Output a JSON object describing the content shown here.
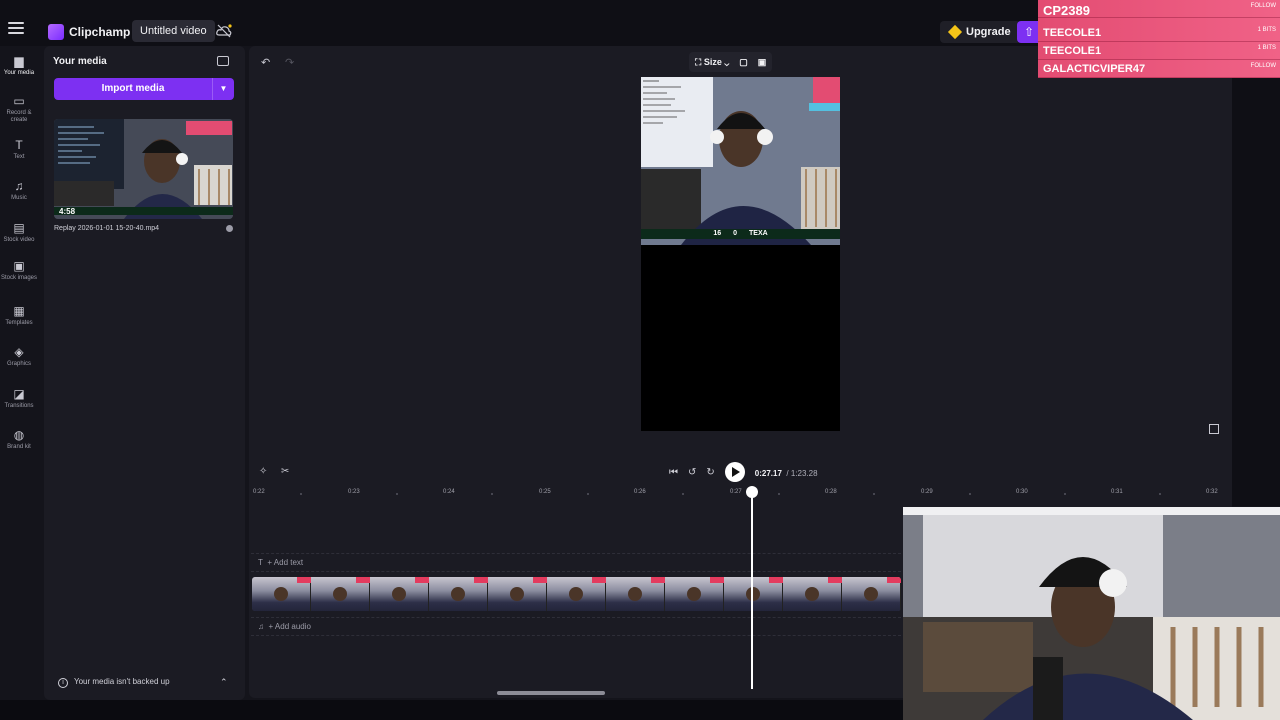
{
  "topbar": {
    "app_name": "Clipchamp",
    "project_title": "Untitled video",
    "upgrade_label": "Upgrade"
  },
  "rail": {
    "items": [
      {
        "label": "Your media",
        "icon": "folder-icon"
      },
      {
        "label": "Record & create",
        "icon": "camera-icon"
      },
      {
        "label": "Text",
        "icon": "text-icon"
      },
      {
        "label": "Music",
        "icon": "music-icon"
      },
      {
        "label": "Stock video",
        "icon": "film-icon"
      },
      {
        "label": "Stock images",
        "icon": "image-icon"
      },
      {
        "label": "Templates",
        "icon": "templates-icon"
      },
      {
        "label": "Graphics",
        "icon": "shapes-icon"
      },
      {
        "label": "Transitions",
        "icon": "transitions-icon"
      },
      {
        "label": "Brand kit",
        "icon": "brand-kit-icon"
      }
    ]
  },
  "media_panel": {
    "title": "Your media",
    "import_label": "Import media",
    "clip": {
      "duration": "4:58",
      "filename": "Replay 2026-01-01 15-20-40.mp4"
    },
    "backup_note": "Your media isn't backed up"
  },
  "preview": {
    "size_label": "Size",
    "score": {
      "left": "16",
      "right": "0",
      "team_right": "TEXA"
    }
  },
  "playback": {
    "current_time": "0:27.17",
    "total_time": "/ 1:23.28"
  },
  "ruler": {
    "labels": [
      "0:22",
      "0:23",
      "0:24",
      "0:25",
      "0:26",
      "0:27",
      "0:28",
      "0:29",
      "0:30",
      "0:31",
      "0:32"
    ]
  },
  "timeline": {
    "add_text_label": "+ Add text",
    "add_audio_label": "+ Add audio"
  },
  "overlay": {
    "rows": [
      {
        "name": "CP2389",
        "tag": "FOLLOW"
      },
      {
        "name": "TEECOLE1",
        "tag": "1 BITS"
      },
      {
        "name": "TEECOLE1",
        "tag": "1 BITS"
      },
      {
        "name": "GALACTICVIPER47",
        "tag": "FOLLOW"
      }
    ]
  },
  "colors": {
    "accent": "#7d30f2",
    "overlay_pink": "#e34c72",
    "background": "#14141b"
  }
}
